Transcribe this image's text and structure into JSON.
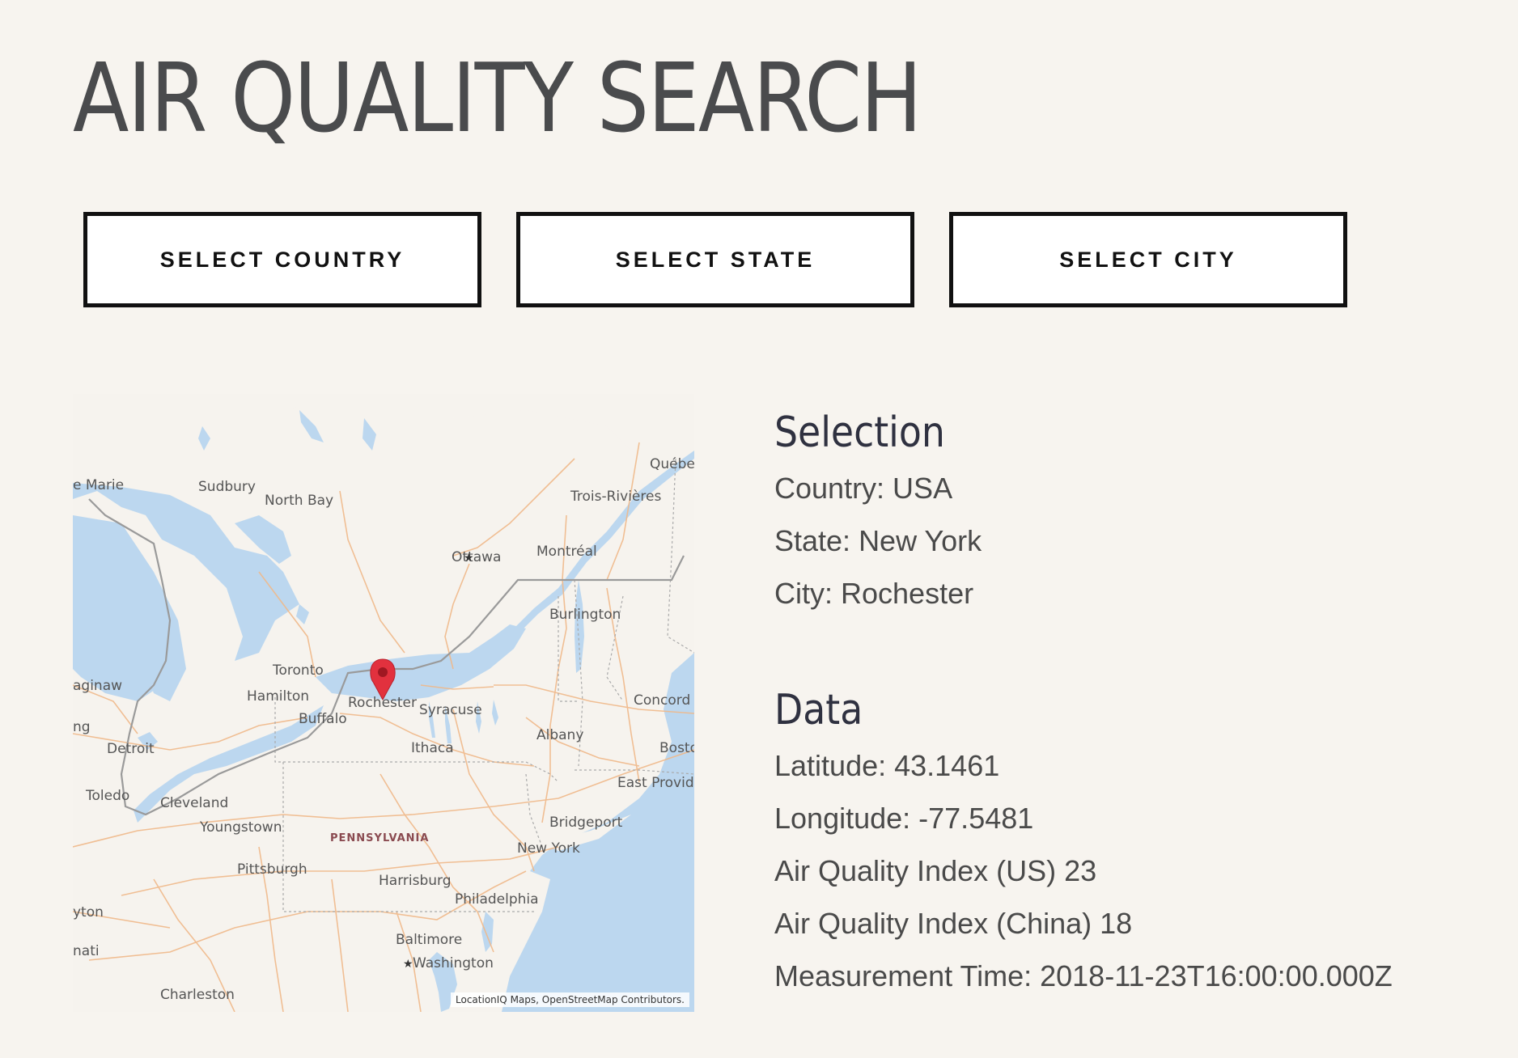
{
  "page": {
    "title": "AIR QUALITY SEARCH"
  },
  "buttons": {
    "country": "SELECT COUNTRY",
    "state": "SELECT STATE",
    "city": "SELECT CITY"
  },
  "map": {
    "attribution": "LocationIQ Maps, OpenStreetMap Contributors.",
    "marker": "map-pin-icon",
    "colors": {
      "water": "#bcd7ef",
      "land": "#f6f3ee",
      "roads": "#f0b98a",
      "border": "#9a9a9a",
      "marker": "#e2313e"
    },
    "places": {
      "marie": "e Marie",
      "sudbury": "Sudbury",
      "north_bay": "North Bay",
      "quebec": "Québe",
      "trois_rivieres": "Trois-Rivières",
      "ottawa": "Ottawa",
      "montreal": "Montréal",
      "burlington": "Burlington",
      "toronto": "Toronto",
      "saginaw": "aginaw",
      "hamilton": "Hamilton",
      "rochester": "Rochester",
      "syracuse": "Syracuse",
      "buffalo": "Buffalo",
      "concord": "Concord",
      "ng": "ng",
      "detroit": "Detroit",
      "ithaca": "Ithaca",
      "albany": "Albany",
      "boston": "Bosto",
      "toledo": "Toledo",
      "cleveland": "Cleveland",
      "east_providence": "East Provide",
      "youngstown": "Youngstown",
      "pennsylvania": "PENNSYLVANIA",
      "bridgeport": "Bridgeport",
      "new_york": "New York",
      "pittsburgh": "Pittsburgh",
      "harrisburg": "Harrisburg",
      "philadelphia": "Philadelphia",
      "dayton": "yton",
      "baltimore": "Baltimore",
      "cincinnati": "nati",
      "washington": "Washington",
      "charleston": "Charleston"
    }
  },
  "selection": {
    "heading": "Selection",
    "country": "Country: USA",
    "state": "State: New York",
    "city": "City: Rochester"
  },
  "data": {
    "heading": "Data",
    "latitude": "Latitude: 43.1461",
    "longitude": "Longitude: -77.5481",
    "aqi_us": "Air Quality Index (US) 23",
    "aqi_china": "Air Quality Index (China) 18",
    "measurement_time": "Measurement Time: 2018-11-23T16:00:00.000Z"
  }
}
